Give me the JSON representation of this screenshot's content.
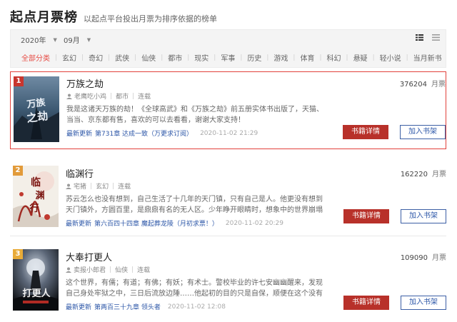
{
  "page": {
    "title": "起点月票榜",
    "subtitle": "以起点平台投出月票为排序依据的榜单"
  },
  "filters": {
    "year": "2020年",
    "month": "09月",
    "categories": [
      "全部分类",
      "玄幻",
      "奇幻",
      "武侠",
      "仙侠",
      "都市",
      "现实",
      "军事",
      "历史",
      "游戏",
      "体育",
      "科幻",
      "悬疑",
      "轻小说",
      "当月新书"
    ],
    "active_category": "全部分类"
  },
  "labels": {
    "update": "最新更新",
    "detail_button": "书籍详情",
    "shelf_button": "加入书架",
    "vote_unit": "月票"
  },
  "books": [
    {
      "rank": "1",
      "name": "万族之劫",
      "author": "老鹰吃小鸡",
      "category": "都市",
      "status": "连载",
      "intro": "我是这诸天万族的劫！《全球高武》和《万族之劫》前五册实体书出版了，天猫、当当、京东都有售，喜欢的可以去看看，谢谢大家支持！",
      "chapter": "第731章 达成一致（万更求订阅）",
      "time": "2020-11-02 21:29",
      "votes": "376204",
      "cover_text": "万族之劫",
      "highlighted": true
    },
    {
      "rank": "2",
      "name": "临渊行",
      "author": "宅猪",
      "category": "玄幻",
      "status": "连载",
      "intro": "苏云怎么也没有想到，自己生活了十几年的天门镇，只有自己是人。他更没有想到天门镇外，方圆百里，是鼎鼎有名的无人区。少年睁开眼睛时，想象中的世界崩塌了，",
      "chapter": "第六百四十四章 魔起葬龙陵（月初求票！）",
      "time": "2020-11-02 20:29",
      "votes": "162220",
      "cover_text": "临渊行",
      "highlighted": false
    },
    {
      "rank": "3",
      "name": "大奉打更人",
      "author": "卖报小郎君",
      "category": "仙侠",
      "status": "连载",
      "intro": "这个世界，有儒；有道；有佛；有妖；有术士。警校毕业的许七安幽幽醒来，发现自己身处牢狱之中，三日后流放边陲……他起初的目的只是自保，顺便在这个没有人",
      "chapter": "第两百三十九章 领头者",
      "time": "2020-11-02 12:08",
      "votes": "109090",
      "cover_text": "大奉打更人",
      "highlighted": false
    }
  ],
  "colors": {
    "accent": "#b8312a",
    "active_category": "#e64c45",
    "link": "#2d57a8",
    "highlight_border": "#e2413b"
  }
}
